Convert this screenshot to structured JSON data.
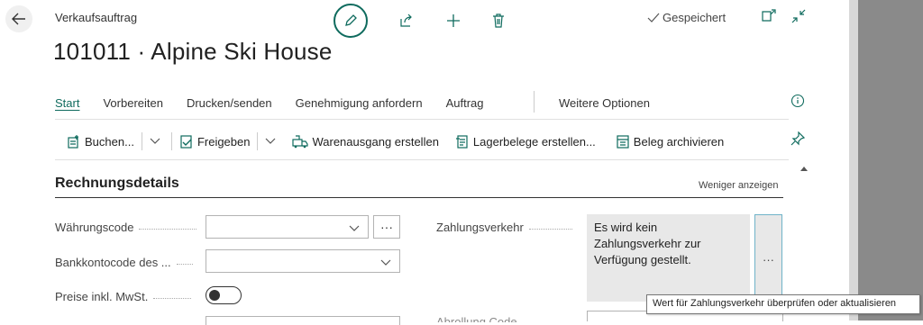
{
  "header": {
    "caption": "Verkaufsauftrag",
    "title": "101011 · Alpine Ski House",
    "saved_status": "Gespeichert"
  },
  "icons": {
    "back": "back-arrow-icon",
    "edit": "pencil-icon",
    "share": "share-icon",
    "new": "plus-icon",
    "delete": "trash-icon",
    "open_new_window": "open-in-new-window-icon",
    "collapse": "collapse-icon",
    "info": "info-icon",
    "pin": "pin-icon"
  },
  "tabs": {
    "items": [
      "Start",
      "Vorbereiten",
      "Drucken/senden",
      "Genehmigung anfordern",
      "Auftrag"
    ],
    "more": "Weitere Optionen",
    "active": "Start"
  },
  "actions": {
    "post": "Buchen...",
    "release": "Freigeben",
    "create_shipment": "Warenausgang erstellen",
    "create_whse_docs": "Lagerbelege erstellen...",
    "archive": "Beleg archivieren"
  },
  "section": {
    "title": "Rechnungsdetails",
    "toggle_label": "Weniger anzeigen"
  },
  "fields": {
    "currency_code": {
      "label": "Währungscode",
      "value": "",
      "ellipsis": "···"
    },
    "bank_account": {
      "label": "Bankkontocode des ...",
      "value": ""
    },
    "prices_incl_vat": {
      "label": "Preise inkl. MwSt.",
      "checked": false
    },
    "payment_services": {
      "label": "Zahlungsverkehr",
      "value": "Es wird kein Zahlungsverkehr zur Verfügung gestellt.",
      "button": "···"
    },
    "partial_label": "Abrollung Code"
  },
  "tooltip": "Wert für Zahlungsverkehr überprüfen oder aktualisieren",
  "colors": {
    "accent": "#0f6b5e",
    "payment_box_bg": "#e8e8e8",
    "payment_btn_border": "#6fb3c9"
  }
}
